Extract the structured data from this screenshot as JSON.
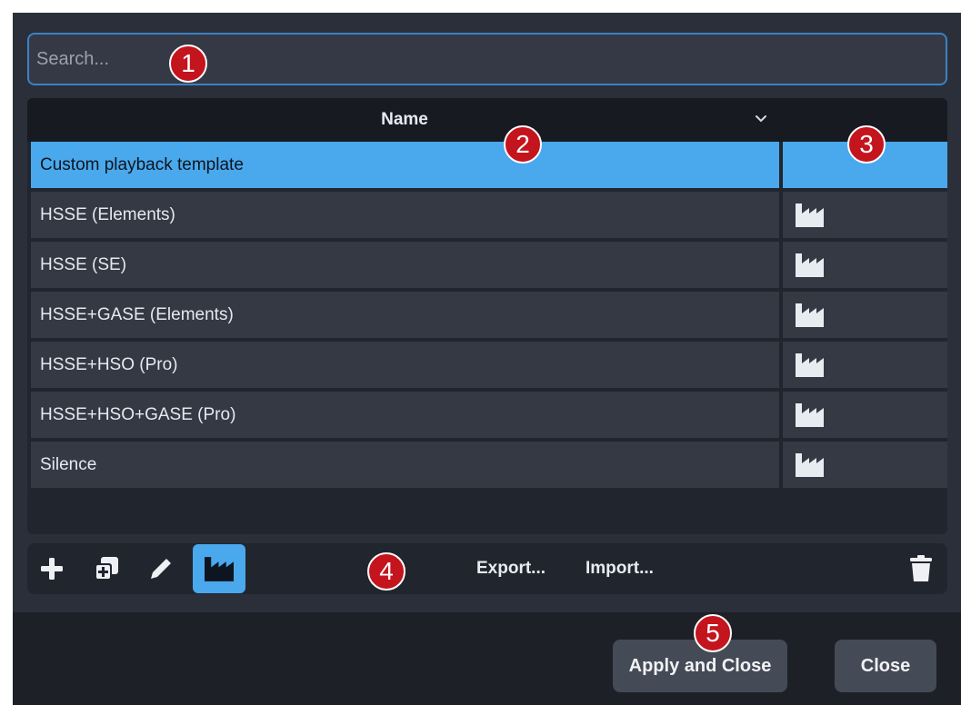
{
  "search": {
    "placeholder": "Search...",
    "value": ""
  },
  "table": {
    "column_name": "Name",
    "rows": [
      {
        "name": "Custom playback template",
        "icon": ""
      },
      {
        "name": "HSSE (Elements)",
        "icon": "factory-icon"
      },
      {
        "name": "HSSE (SE)",
        "icon": "factory-icon"
      },
      {
        "name": "HSSE+GASE (Elements)",
        "icon": "factory-icon"
      },
      {
        "name": "HSSE+HSO (Pro)",
        "icon": "factory-icon"
      },
      {
        "name": "HSSE+HSO+GASE (Pro)",
        "icon": "factory-icon"
      },
      {
        "name": "Silence",
        "icon": "factory-icon"
      }
    ]
  },
  "toolbar": {
    "icons": [
      "plus-icon",
      "duplicate-icon",
      "pencil-icon",
      "factory-icon",
      "trash-icon"
    ],
    "export_label": "Export...",
    "import_label": "Import..."
  },
  "footer": {
    "apply_label": "Apply and Close",
    "close_label": "Close"
  },
  "callouts": [
    "1",
    "2",
    "3",
    "4",
    "5"
  ],
  "colors": {
    "background": "#2b2f3a",
    "accent": "#4aa8ec",
    "row": "#343944",
    "callout": "#c4141e"
  }
}
